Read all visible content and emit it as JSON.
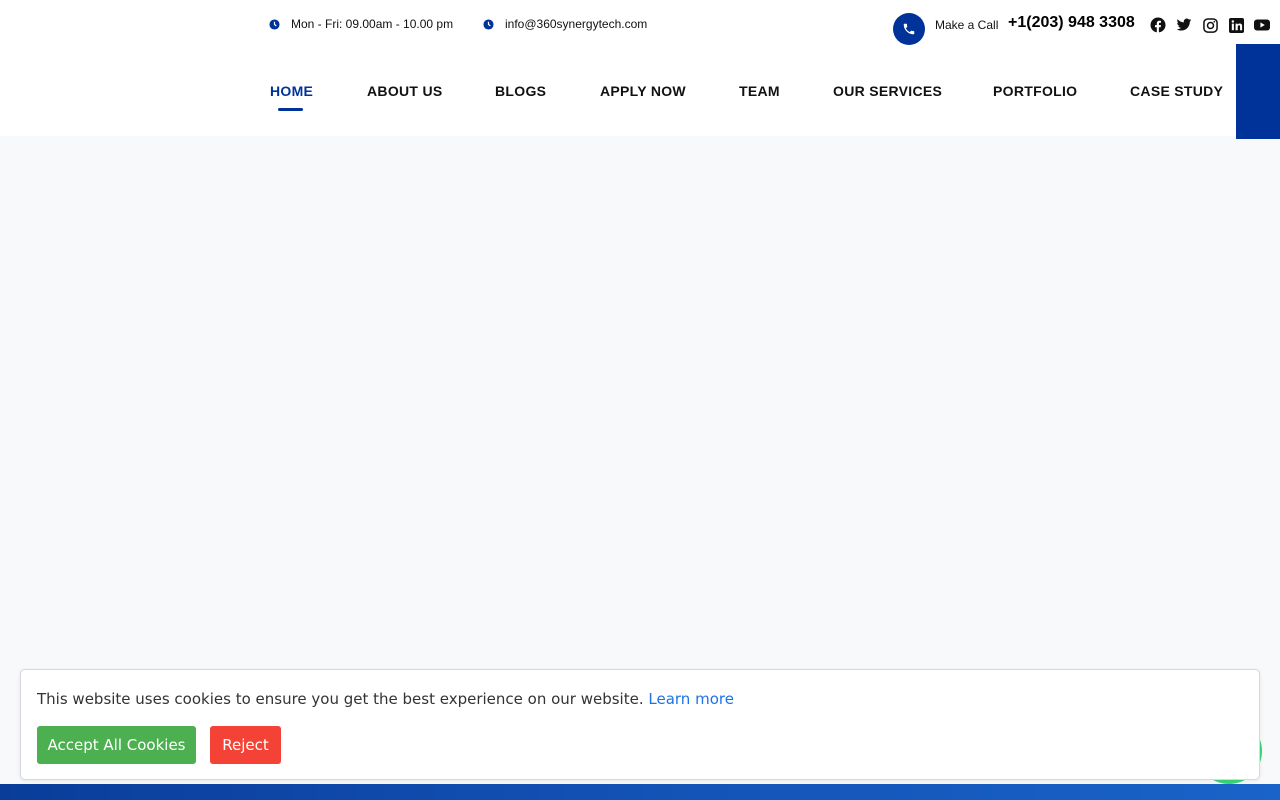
{
  "topbar": {
    "hours": "Mon - Fri: 09.00am - 10.00 pm",
    "email": "info@360synergytech.com",
    "call_label": "Make a Call",
    "phone": "+1(203) 948 3308",
    "socials": [
      "facebook-icon",
      "twitter-icon",
      "instagram-icon",
      "linkedin-icon",
      "youtube-icon"
    ]
  },
  "nav": {
    "items": [
      {
        "label": "HOME",
        "active": true
      },
      {
        "label": "ABOUT US",
        "active": false
      },
      {
        "label": "BLOGS",
        "active": false
      },
      {
        "label": "APPLY NOW",
        "active": false
      },
      {
        "label": "TEAM",
        "active": false
      },
      {
        "label": "OUR SERVICES",
        "active": false
      },
      {
        "label": "PORTFOLIO",
        "active": false
      },
      {
        "label": "CASE STUDY",
        "active": false
      }
    ]
  },
  "cookie": {
    "message": "This website uses cookies to ensure you get the best experience on our website.",
    "learn_more": "Learn more",
    "accept_label": "Accept All Cookies",
    "reject_label": "Reject"
  },
  "colors": {
    "brand": "#003399",
    "accept": "#4caf50",
    "reject": "#f44336",
    "link": "#1a73e8"
  }
}
